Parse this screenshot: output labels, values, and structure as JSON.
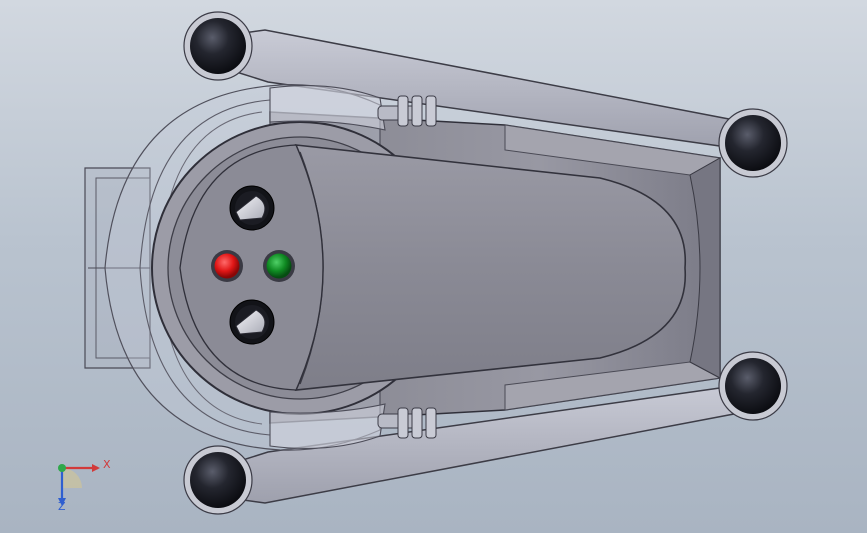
{
  "viewport": {
    "background_top": "#d2d8e0",
    "background_bottom": "#a9b4c2"
  },
  "model": {
    "body_color": "#8f8f9b",
    "wheel_color": "#1e1f26",
    "control_panel": {
      "knob_icon": "rotary-knob-icon",
      "buttons": [
        {
          "color": "#e01616",
          "name": "red-button"
        },
        {
          "color": "#0f8a22",
          "name": "green-button"
        }
      ]
    }
  },
  "triad": {
    "x_label": "X",
    "z_label": "Z",
    "x_color": "#d23a3a",
    "y_color": "#2fa84a",
    "z_color": "#2f5fd0"
  }
}
